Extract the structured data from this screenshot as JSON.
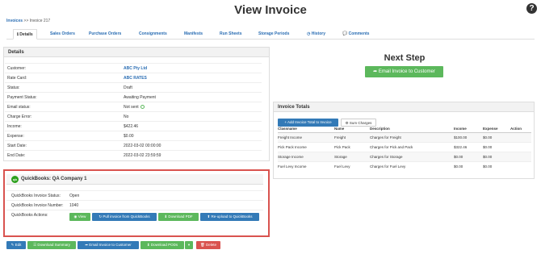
{
  "header": {
    "title": "View Invoice",
    "help_icon": "question-circle-icon"
  },
  "breadcrumb": {
    "root": "Invoices",
    "separator": ">>",
    "current": "Invoice 217"
  },
  "tabs": [
    {
      "label": "Details",
      "icon": "info-icon",
      "active": true
    },
    {
      "label": "Sales Orders"
    },
    {
      "label": "Purchase Orders"
    },
    {
      "label": "Consignments"
    },
    {
      "label": "Manifests"
    },
    {
      "label": "Run Sheets"
    },
    {
      "label": "Storage Periods"
    },
    {
      "label": "History",
      "icon": "clock-icon"
    },
    {
      "label": "Comments",
      "icon": "comment-icon"
    }
  ],
  "details": {
    "heading": "Details",
    "rows": [
      {
        "label": "Customer:",
        "value": "ABC Pty Ltd"
      },
      {
        "label": "Rate Card:",
        "value": "ABC RATES"
      },
      {
        "label": "Status:",
        "value": "Draft"
      },
      {
        "label": "Payment Status:",
        "value": "Awaiting Payment"
      },
      {
        "label": "Email status:",
        "value": "Not sent"
      },
      {
        "label": "Charge Error:",
        "value": "No"
      },
      {
        "label": "Income:",
        "value": "$422.46"
      },
      {
        "label": "Expense:",
        "value": "$0.00"
      },
      {
        "label": "Start Date:",
        "value": "2022-03-02 00:00:00"
      },
      {
        "label": "End Date:",
        "value": "2022-03-02 23:59:59"
      }
    ]
  },
  "quickbooks": {
    "title": "QuickBooks: QA Company 1",
    "logo_text": "qb",
    "status_label": "QuickBooks Invoice Status:",
    "status_value": "Open",
    "number_label": "QuickBooks Invoice Number:",
    "number_value": "1040",
    "actions_label": "QuickBooks Actions:",
    "actions": {
      "view": "View",
      "pull": "Pull invoice from QuickBooks",
      "pdf": "Download PDF",
      "reupload": "Re-upload to QuickBooks"
    }
  },
  "bottom_actions": {
    "edit": "Edit",
    "summary": "Download Summary",
    "email": "Email Invoice to Customer",
    "pods": "Download PODs",
    "pods_caret": "▾",
    "delete": "Delete"
  },
  "next_step": {
    "title": "Next Step",
    "button": "Email Invoice to Customer"
  },
  "invoice_totals": {
    "heading": "Invoice Totals",
    "add_button": "Add Invoice Total to Invoice",
    "sum_button": "Sum Charges",
    "columns": [
      "Classname",
      "Name",
      "Description",
      "Income",
      "Expense",
      "Action"
    ],
    "rows": [
      [
        "Freight Income",
        "Freight",
        "Charges for Freight",
        "$100.00",
        "$0.00",
        ""
      ],
      [
        "Pick Pack Income",
        "Pick Pack",
        "Charges for Pick and Pack",
        "$322.46",
        "$0.00",
        ""
      ],
      [
        "Storage Income",
        "Storage",
        "Charges for Storage",
        "$0.00",
        "$0.00",
        ""
      ],
      [
        "Fuel Levy Income",
        "Fuel Levy",
        "Charges for Fuel Levy",
        "$0.00",
        "$0.00",
        ""
      ]
    ]
  },
  "colors": {
    "link": "#2a6db3",
    "success": "#5cb85c",
    "primary": "#337ab7",
    "danger": "#d9534f",
    "quickbooks": "#2ca01c"
  }
}
